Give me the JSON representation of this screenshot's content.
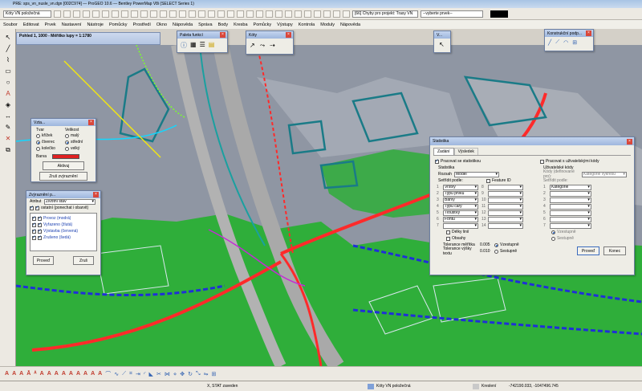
{
  "window": {
    "title": "PRE: sps_vn_nusle_vn.dgn [002C974] — ProGEO 10.6 — Bentley PowerMap V8i (SELECT Series 1)"
  },
  "toolbar": {
    "level_combo": "Kóty VN položečná",
    "errors_combo": "[66] Chyby pro projekt: Trasy VN",
    "element_combo": "--vyberte prvek--"
  },
  "menu": [
    "Soubor",
    "Editovat",
    "Prvek",
    "Nastavení",
    "Nástroje",
    "Pomůcky",
    "Prostředí",
    "Okno",
    "Nápověda",
    "Správa",
    "Body",
    "Kresba",
    "Pomůcky",
    "Výstupy",
    "Kontrola",
    "Moduly",
    "Nápověda"
  ],
  "view": {
    "title": "Pohled 1, 1000 - Měřítko lupy = 1:1780"
  },
  "panels": {
    "paleta": {
      "title": "Paleta funkcí"
    },
    "koty": {
      "title": "Kóty"
    },
    "v": {
      "title": "V..."
    },
    "konstrukcni": {
      "title": "Konstrukční podp..."
    }
  },
  "vztazny": {
    "title": "Vzta...",
    "tvar_label": "Tvar",
    "velikost_label": "Velikost",
    "tvar_options": [
      "křížek",
      "čtverec",
      "kolečko"
    ],
    "velikost_options": [
      "malý",
      "střední",
      "velký"
    ],
    "barva_label": "Barva",
    "color": "#e02020",
    "aktivuj": "Aktivuj",
    "zrus": "Zruš zvýraznění"
  },
  "zvyrazneni": {
    "title": "Zvýraznění p...",
    "atribut_label": "Atribut",
    "atribut_value": "Životní stav",
    "ostatni": "ostatní (ponechat i obarvit)",
    "items": [
      "Provoz (modrá)",
      "Vyřazeno (žlutá)",
      "Výstavba (červená)",
      "Zrušeno (šedá)"
    ],
    "proved": "Proveď",
    "zrus": "Zruš"
  },
  "statistika": {
    "title": "Statistika",
    "tabs": [
      "Zadání",
      "Výsledek"
    ],
    "pracovat_stat": "Pracovat se statistikou",
    "statistika_label": "Statistika",
    "rozsah_label": "Rozsah",
    "rozsah_value": "Model",
    "pracovat_uziv": "Pracovat s uživatelskými kódy",
    "uziv_kody": "Uživatelské kódy",
    "kody_label": "Kódy (definované pro):",
    "kody_value": "Kategorie výkresu",
    "setridit_left": "Setřídit podle:",
    "feature_id": "Feature ID",
    "setridit_right": "Setřídit podle:",
    "left_sorts": [
      "Vrstvy",
      "Typu prvků",
      "Barvy",
      "Typu čáry",
      "Tloušťky",
      "Fontu",
      ""
    ],
    "mid_numbers": [
      "8",
      "9",
      "10",
      "11",
      "12",
      "13",
      "14"
    ],
    "right_sorts": [
      "Kategorie",
      "",
      "",
      "",
      "",
      "",
      ""
    ],
    "left_numbers": [
      "1",
      "2",
      "3",
      "4",
      "5",
      "6",
      "7"
    ],
    "delky": "Délky linií",
    "obsahy": "Obsahy",
    "tol_meritka_label": "Tolerance měřítka",
    "tol_meritka_value": "0.005",
    "tol_vysky_label": "Tolerance výšky textu",
    "tol_vysky_value": "0.010",
    "vzestupne": "Vzestupně",
    "sestupne": "Sestupně",
    "vzestupne2": "Vzestupně",
    "sestupne2": "Sestupně",
    "proved": "Proveď",
    "konec": "Konec"
  },
  "status": {
    "left": "X, STAT zaveden",
    "level": "Kóty VN položečná",
    "mode": "Kreslení",
    "coords": "-742190.033, -1047496.745"
  }
}
